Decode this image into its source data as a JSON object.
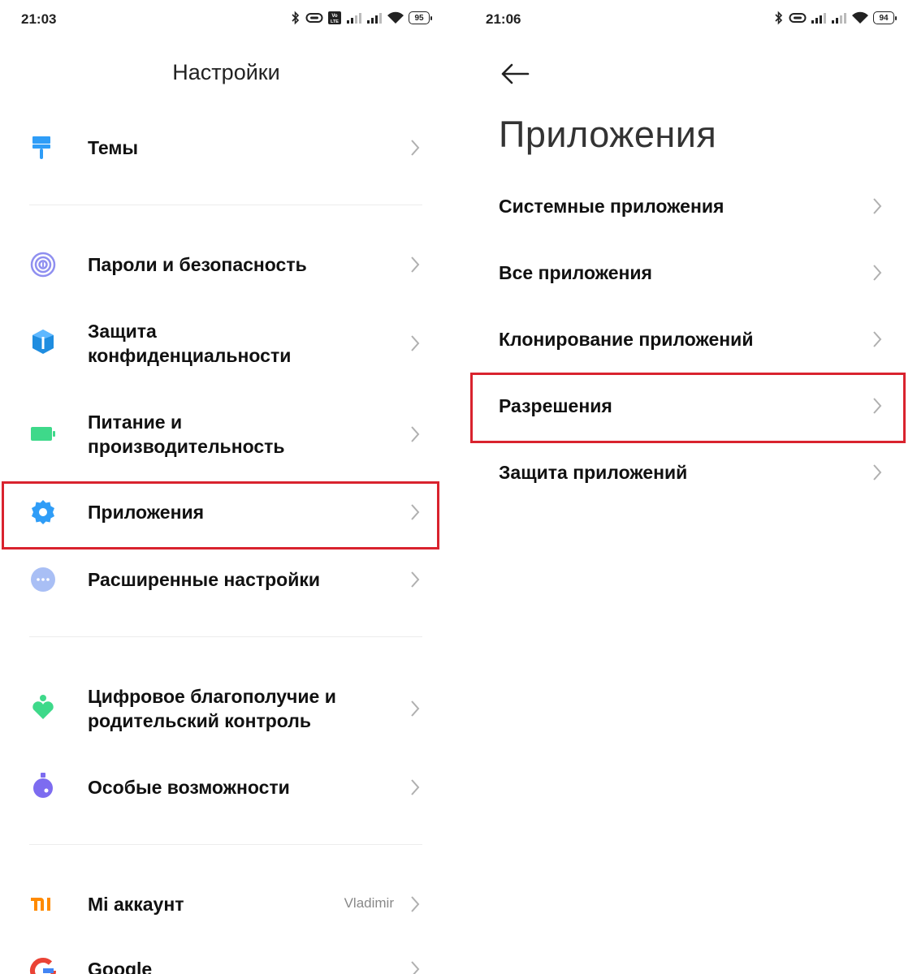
{
  "left": {
    "status": {
      "time": "21:03",
      "battery": "95",
      "icons": [
        "bluetooth-icon",
        "link-icon",
        "volte-icon",
        "signal-icon",
        "signal-icon",
        "wifi-icon",
        "battery-icon"
      ]
    },
    "title": "Настройки",
    "items": [
      {
        "label": "Темы",
        "icon": "themes-icon"
      },
      {
        "label": "Пароли и безопасность",
        "icon": "fingerprint-icon"
      },
      {
        "label": "Защита\nконфиденциальности",
        "icon": "privacy-shield-icon"
      },
      {
        "label": "Питание и\nпроизводительность",
        "icon": "battery-power-icon"
      },
      {
        "label": "Приложения",
        "icon": "gear-icon"
      },
      {
        "label": "Расширенные настройки",
        "icon": "more-dots-icon"
      },
      {
        "label": "Цифровое благополучие и\nродительский контроль",
        "icon": "wellbeing-icon"
      },
      {
        "label": "Особые возможности",
        "icon": "accessibility-flask-icon"
      },
      {
        "label": "Mi аккаунт",
        "icon": "mi-logo-icon",
        "value": "Vladimir"
      },
      {
        "label": "Google",
        "icon": "google-logo-icon"
      }
    ],
    "highlight_color": "#d9232e"
  },
  "right": {
    "status": {
      "time": "21:06",
      "battery": "94",
      "icons": [
        "bluetooth-icon",
        "link-icon",
        "signal-icon",
        "signal-icon",
        "wifi-icon",
        "battery-icon"
      ]
    },
    "title": "Приложения",
    "items": [
      {
        "label": "Системные приложения"
      },
      {
        "label": "Все приложения"
      },
      {
        "label": "Клонирование приложений"
      },
      {
        "label": "Разрешения"
      },
      {
        "label": "Защита приложений"
      }
    ]
  }
}
